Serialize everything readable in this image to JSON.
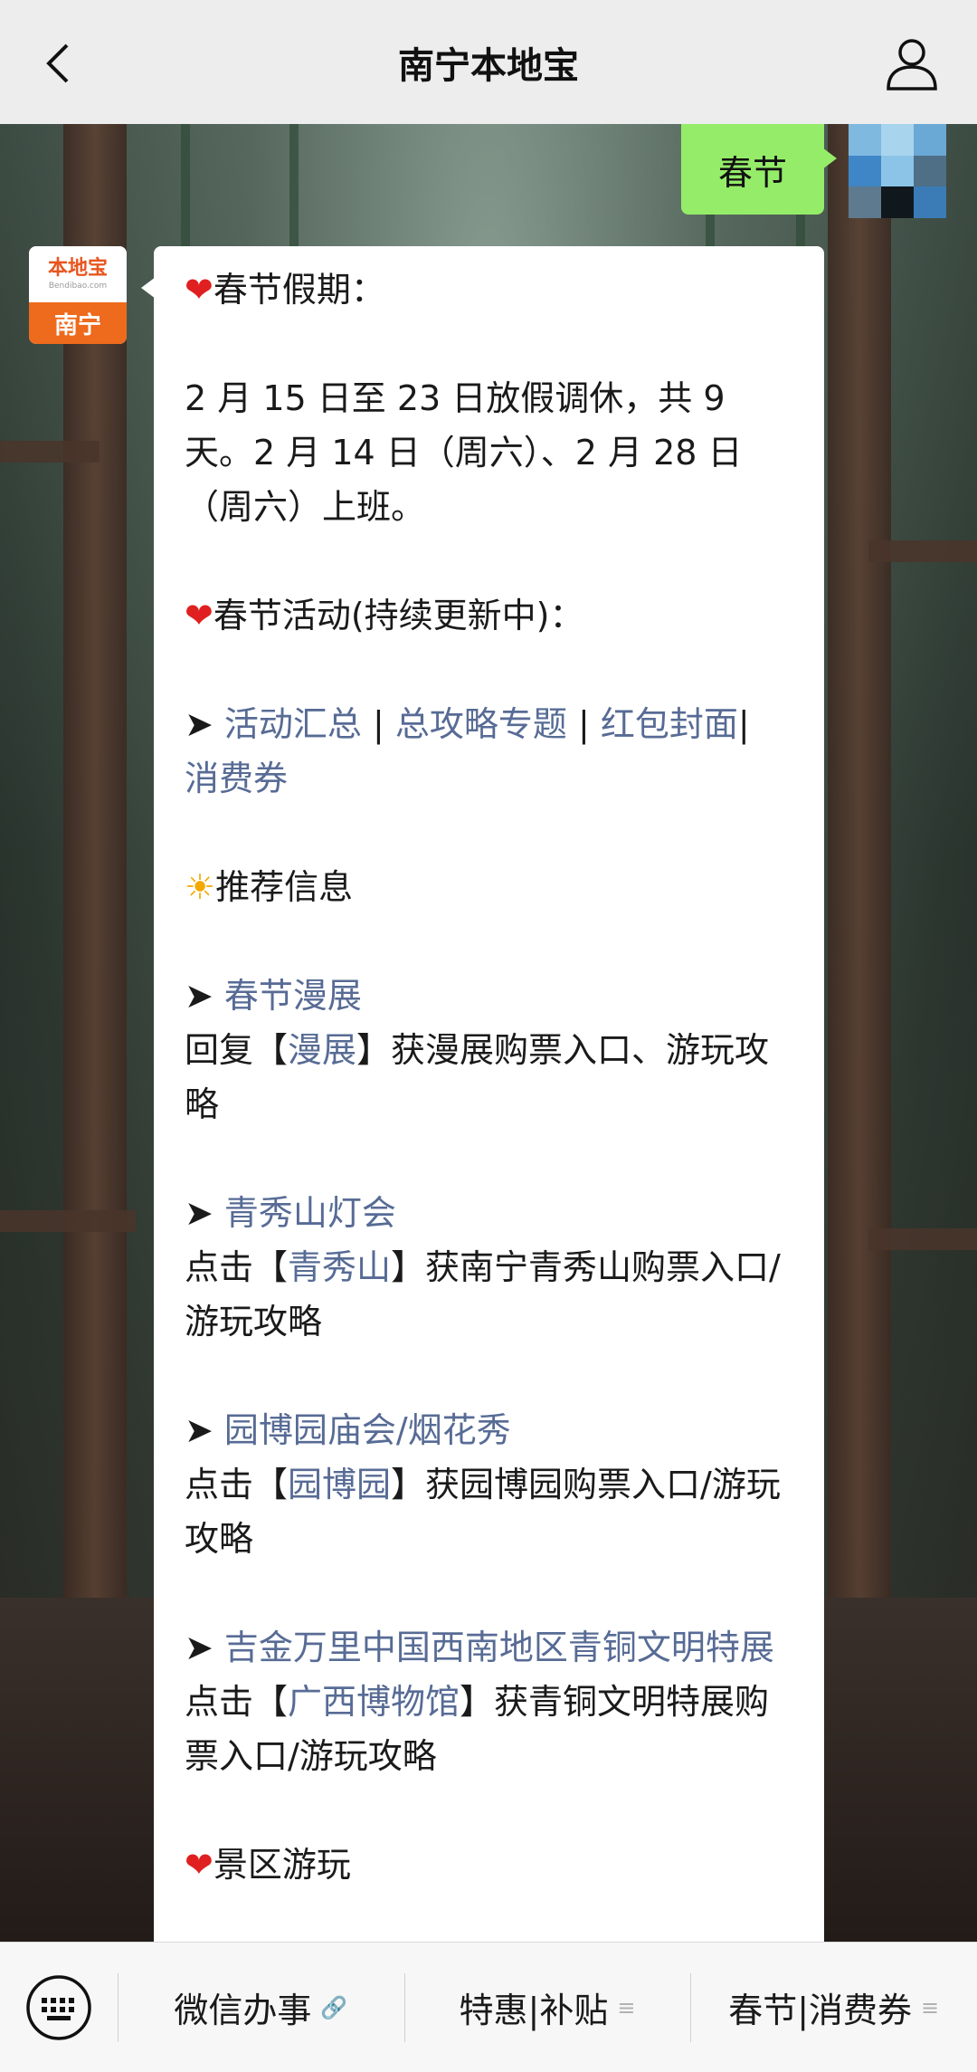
{
  "header": {
    "title": "南宁本地宝"
  },
  "sent_message": {
    "text": "春节"
  },
  "bot": {
    "avatar_brand": "本地宝",
    "avatar_domain": "Bendibao.com",
    "avatar_city": "南宁"
  },
  "message": {
    "holiday_heading": "春节假期：",
    "holiday_text": "2 月 15 日至 23 日放假调休，共 9 天。2 月 14 日（周六）、2 月 28 日（周六）上班。",
    "activity_heading": "春节活动(持续更新中)：",
    "activity_links": [
      "活动汇总",
      "总攻略专题",
      "红包封面",
      "消费券"
    ],
    "recommend_heading": "推荐信息",
    "items": [
      {
        "title": "春节漫展",
        "prefix": "回复【",
        "keyword": "漫展",
        "suffix": "】获漫展购票入口、游玩攻略"
      },
      {
        "title": "青秀山灯会",
        "prefix": "点击【",
        "keyword": "青秀山",
        "suffix": "】获南宁青秀山购票入口/游玩攻略"
      },
      {
        "title": "园博园庙会/烟花秀",
        "prefix": "点击【",
        "keyword": "园博园",
        "suffix": "】获园博园购票入口/游玩攻略"
      },
      {
        "title": "吉金万里中国西南地区青铜文明特展",
        "prefix": "点击【",
        "keyword": "广西博物馆",
        "suffix": "】获青铜文明特展购票入口/游玩攻略"
      }
    ],
    "scenic_heading": "景区游玩"
  },
  "bottom_menu": [
    {
      "label": "微信办事",
      "icon": "link-icon"
    },
    {
      "label": "特惠|补贴",
      "icon": "menu-icon"
    },
    {
      "label": "春节|消费券",
      "icon": "menu-icon"
    }
  ],
  "colors": {
    "link": "#576b95",
    "sent_bubble": "#95ec69",
    "brand_orange": "#ee6a1c"
  }
}
